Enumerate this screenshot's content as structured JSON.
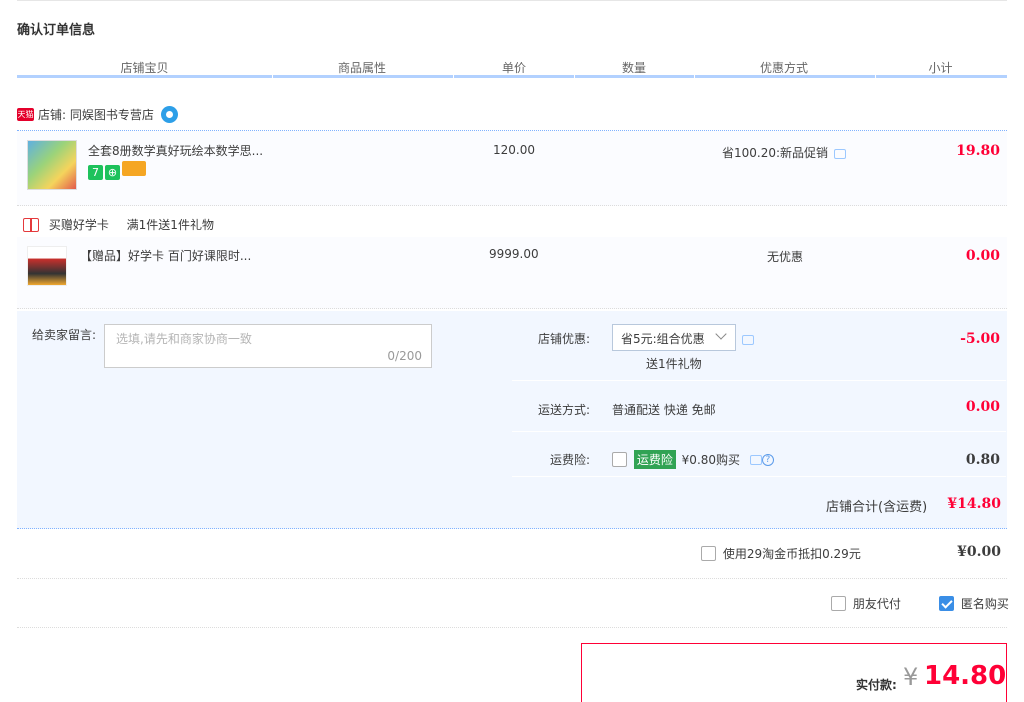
{
  "page_title": "确认订单信息",
  "columns": [
    "店铺宝贝",
    "商品属性",
    "单价",
    "数量",
    "优惠方式",
    "小计"
  ],
  "shop": {
    "badge": "天猫",
    "label": "店铺: 同娱图书专营店"
  },
  "item1": {
    "name": "全套8册数学真好玩绘本数学思...",
    "badges": [
      "7",
      "⊕",
      ""
    ],
    "unit_price": "120.00",
    "promotion": "省100.20:新品促销",
    "subtotal": "19.80"
  },
  "gift": {
    "label": "买赠好学卡",
    "rule": "满1件送1件礼物"
  },
  "item2": {
    "name": "【赠品】好学卡 百门好课限时...",
    "unit_price": "9999.00",
    "promotion": "无优惠",
    "subtotal": "0.00"
  },
  "memo": {
    "label": "给卖家留言:",
    "placeholder": "选填,请先和商家协商一致",
    "count": "0/200"
  },
  "shop_discount": {
    "label": "店铺优惠:",
    "selected": "省5元:组合优惠",
    "note": "送1件礼物",
    "value": "-5.00"
  },
  "shipping": {
    "label": "运送方式:",
    "method": "普通配送 快递 免邮",
    "value": "0.00"
  },
  "insurance": {
    "label": "运费险:",
    "tag": "运费险",
    "price_text": "¥0.80购买",
    "value": "0.80"
  },
  "shop_total": {
    "label": "店铺合计(含运费)",
    "value": "¥14.80"
  },
  "coins": {
    "label": "使用29淘金币抵扣0.29元",
    "value": "¥0.00"
  },
  "options": {
    "friend_pay": "朋友代付",
    "anonymous": "匿名购买"
  },
  "pay": {
    "label": "实付款:",
    "currency": "¥",
    "amount": "14.80"
  },
  "colors": {
    "accent_red": "#ff0036",
    "header_line": "#b2d1ff",
    "panel_bg": "#f2f7ff",
    "checkbox_blue": "#3a8ee6"
  }
}
